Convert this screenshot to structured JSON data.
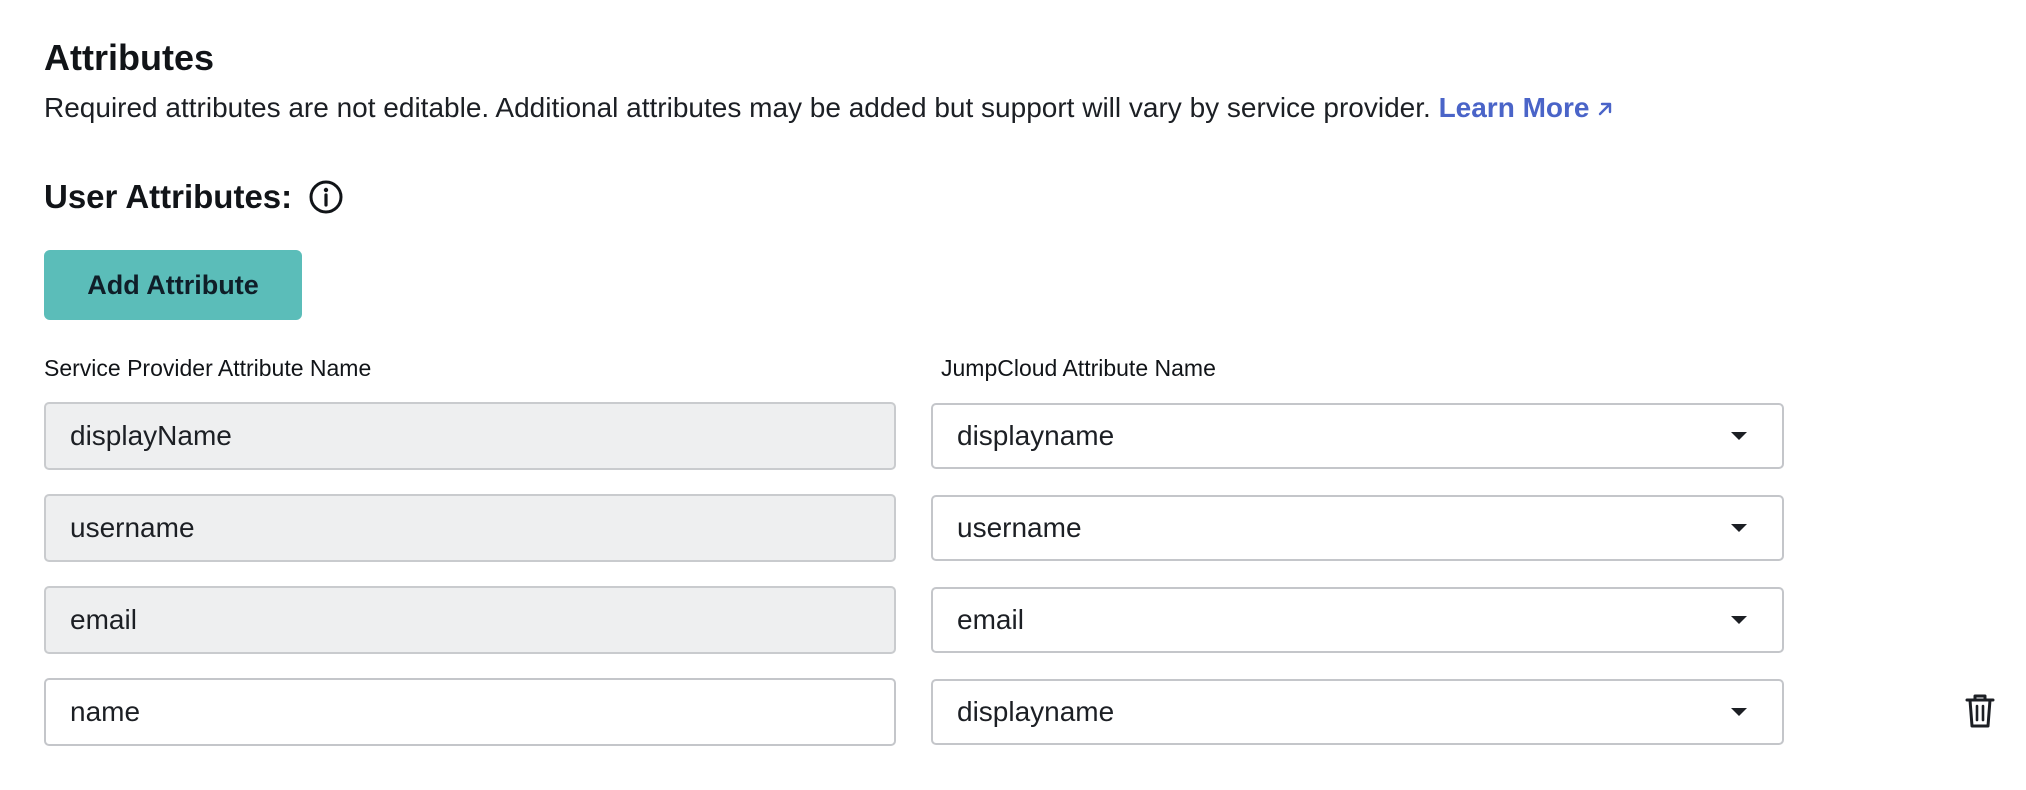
{
  "section": {
    "title": "Attributes",
    "description": "Required attributes are not editable. Additional attributes may be added but support will vary by service provider.",
    "learn_more_label": "Learn More"
  },
  "user_attributes": {
    "label": "User Attributes:",
    "info_icon": "info-icon",
    "add_button_label": "Add Attribute",
    "columns": {
      "service_provider": "Service Provider Attribute Name",
      "jumpcloud": "JumpCloud Attribute Name"
    },
    "rows": [
      {
        "sp_name": "displayName",
        "jc_name": "displayname",
        "editable": false
      },
      {
        "sp_name": "username",
        "jc_name": "username",
        "editable": false
      },
      {
        "sp_name": "email",
        "jc_name": "email",
        "editable": false
      },
      {
        "sp_name": "name",
        "jc_name": "displayname",
        "editable": true,
        "deletable": true
      }
    ]
  },
  "colors": {
    "accent_teal": "#5bbdb9",
    "link_blue": "#4a64c8",
    "readonly_bg": "#eeeff0"
  }
}
